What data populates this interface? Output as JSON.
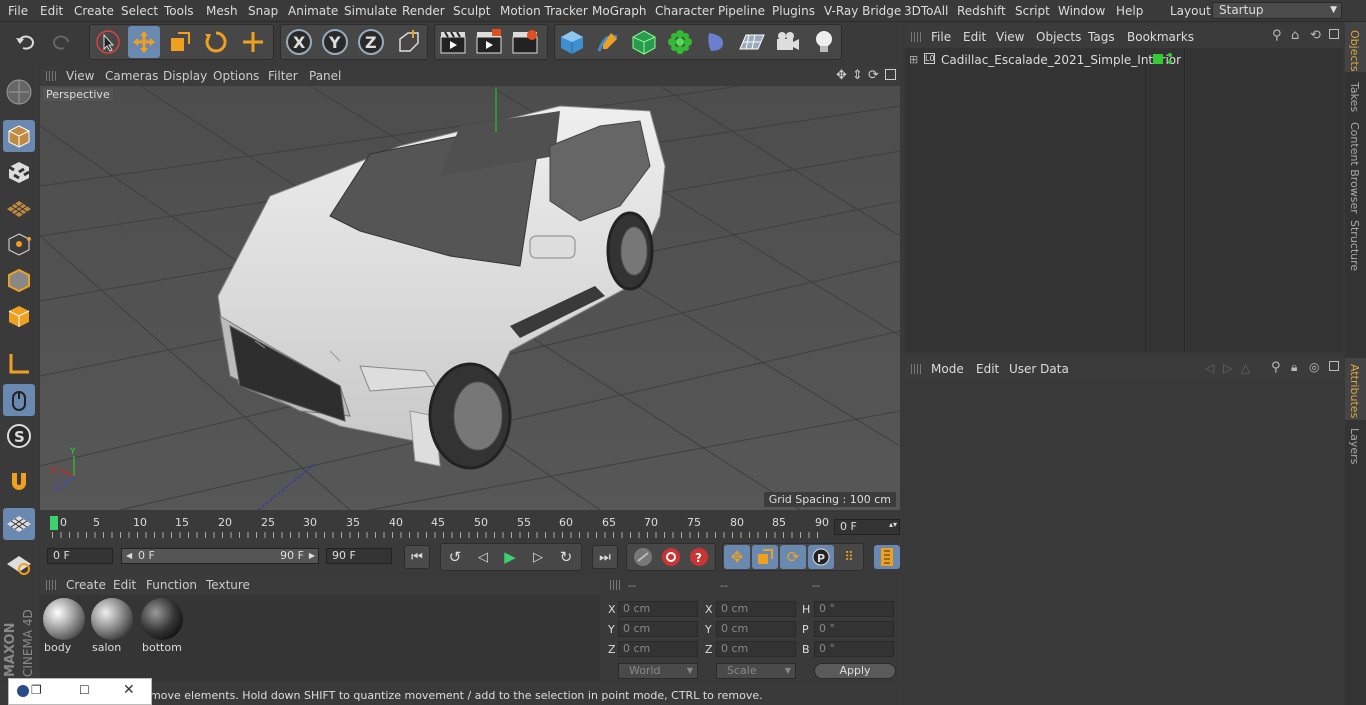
{
  "menubar": {
    "items": [
      "File",
      "Edit",
      "Create",
      "Select",
      "Tools",
      "Mesh",
      "Snap",
      "Animate",
      "Simulate",
      "Render",
      "Sculpt",
      "Motion Tracker",
      "MoGraph",
      "Character",
      "Pipeline",
      "Plugins",
      "V-Ray Bridge",
      "3DToAll",
      "Redshift",
      "Script",
      "Window",
      "Help"
    ],
    "layout_label": "Layout:",
    "layout_value": "Startup"
  },
  "viewport": {
    "menu": [
      "View",
      "Cameras",
      "Display",
      "Options",
      "Filter",
      "Panel"
    ],
    "label": "Perspective",
    "grid_spacing": "Grid Spacing : 100 cm",
    "axis_x": "X",
    "axis_y": "Y",
    "axis_z": "Z"
  },
  "timeline": {
    "ticks": [
      "0",
      "5",
      "10",
      "15",
      "20",
      "25",
      "30",
      "35",
      "40",
      "45",
      "50",
      "55",
      "60",
      "65",
      "70",
      "75",
      "80",
      "85",
      "90"
    ],
    "current_frame": "0 F"
  },
  "playbar": {
    "start": "0 F",
    "range_start": "0 F",
    "range_end": "90 F",
    "end": "90 F"
  },
  "materials": {
    "menu": [
      "Create",
      "Edit",
      "Function",
      "Texture"
    ],
    "items": [
      "body",
      "salon",
      "bottom"
    ]
  },
  "coordinates": {
    "headers": [
      "--",
      "--",
      "--"
    ],
    "rows": [
      {
        "l1": "X",
        "v1": "0 cm",
        "l2": "X",
        "v2": "0 cm",
        "l3": "H",
        "v3": "0 °"
      },
      {
        "l1": "Y",
        "v1": "0 cm",
        "l2": "Y",
        "v2": "0 cm",
        "l3": "P",
        "v3": "0 °"
      },
      {
        "l1": "Z",
        "v1": "0 cm",
        "l2": "Z",
        "v2": "0 cm",
        "l3": "B",
        "v3": "0 °"
      }
    ],
    "world": "World",
    "scale": "Scale",
    "apply": "Apply"
  },
  "objects": {
    "menu": [
      "File",
      "Edit",
      "View",
      "Objects",
      "Tags",
      "Bookmarks"
    ],
    "tree": [
      {
        "name": "Cadillac_Escalade_2021_Simple_Interior"
      }
    ]
  },
  "attributes": {
    "menu": [
      "Mode",
      "Edit",
      "User Data"
    ]
  },
  "sidetabs": [
    "Objects",
    "Takes",
    "Content Browser",
    "Structure",
    "Attributes",
    "Layers"
  ],
  "status": "move elements. Hold down SHIFT to quantize movement / add to the selection in point mode, CTRL to remove.",
  "branding": {
    "maxon": "MAXON",
    "product": "CINEMA 4D"
  },
  "colors": {
    "accent": "#6a89b0",
    "active_tab": "#e0a640"
  }
}
